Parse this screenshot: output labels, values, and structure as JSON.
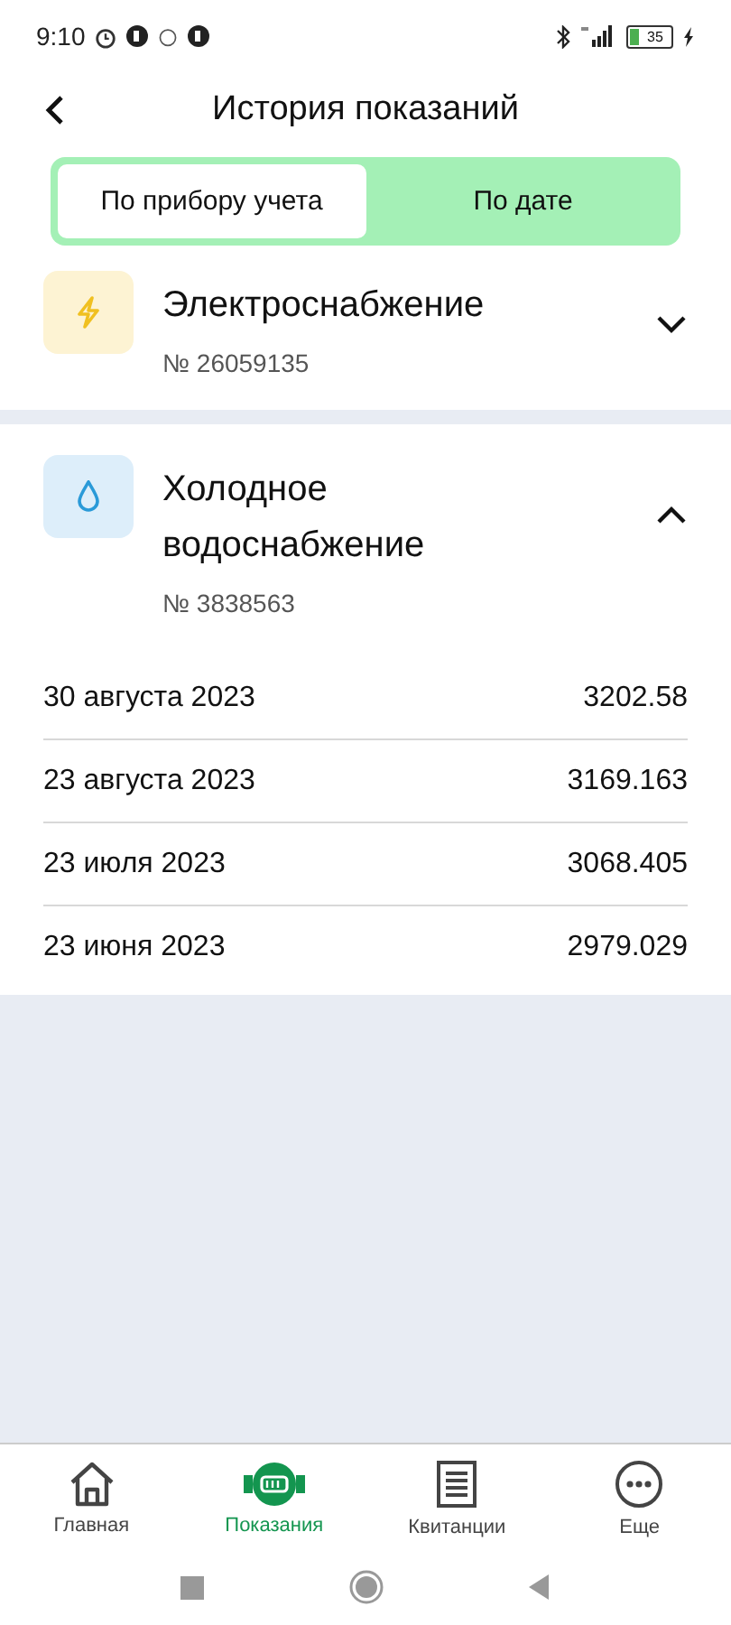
{
  "status_bar": {
    "time": "9:10",
    "battery": "35"
  },
  "header": {
    "title": "История показаний"
  },
  "tabs": [
    {
      "label": "По прибору учета",
      "selected": true
    },
    {
      "label": "По дате",
      "selected": false
    }
  ],
  "meters": [
    {
      "kind": "electricity",
      "name": "Электроснабжение",
      "number": "№ 26059135",
      "expanded": false
    },
    {
      "kind": "water",
      "name": "Холодное водоснабжение",
      "number": "№ 3838563",
      "expanded": true,
      "readings": [
        {
          "date": "30 августа 2023",
          "value": "3202.58"
        },
        {
          "date": "23 августа 2023",
          "value": "3169.163"
        },
        {
          "date": "23 июля 2023",
          "value": "3068.405"
        },
        {
          "date": "23 июня 2023",
          "value": "2979.029"
        }
      ]
    }
  ],
  "bottom_nav": [
    {
      "kind": "home",
      "label": "Главная",
      "selected": false
    },
    {
      "kind": "meter",
      "label": "Показания",
      "selected": true
    },
    {
      "kind": "receipt",
      "label": "Квитанции",
      "selected": false
    },
    {
      "kind": "more",
      "label": "Еще",
      "selected": false
    }
  ]
}
